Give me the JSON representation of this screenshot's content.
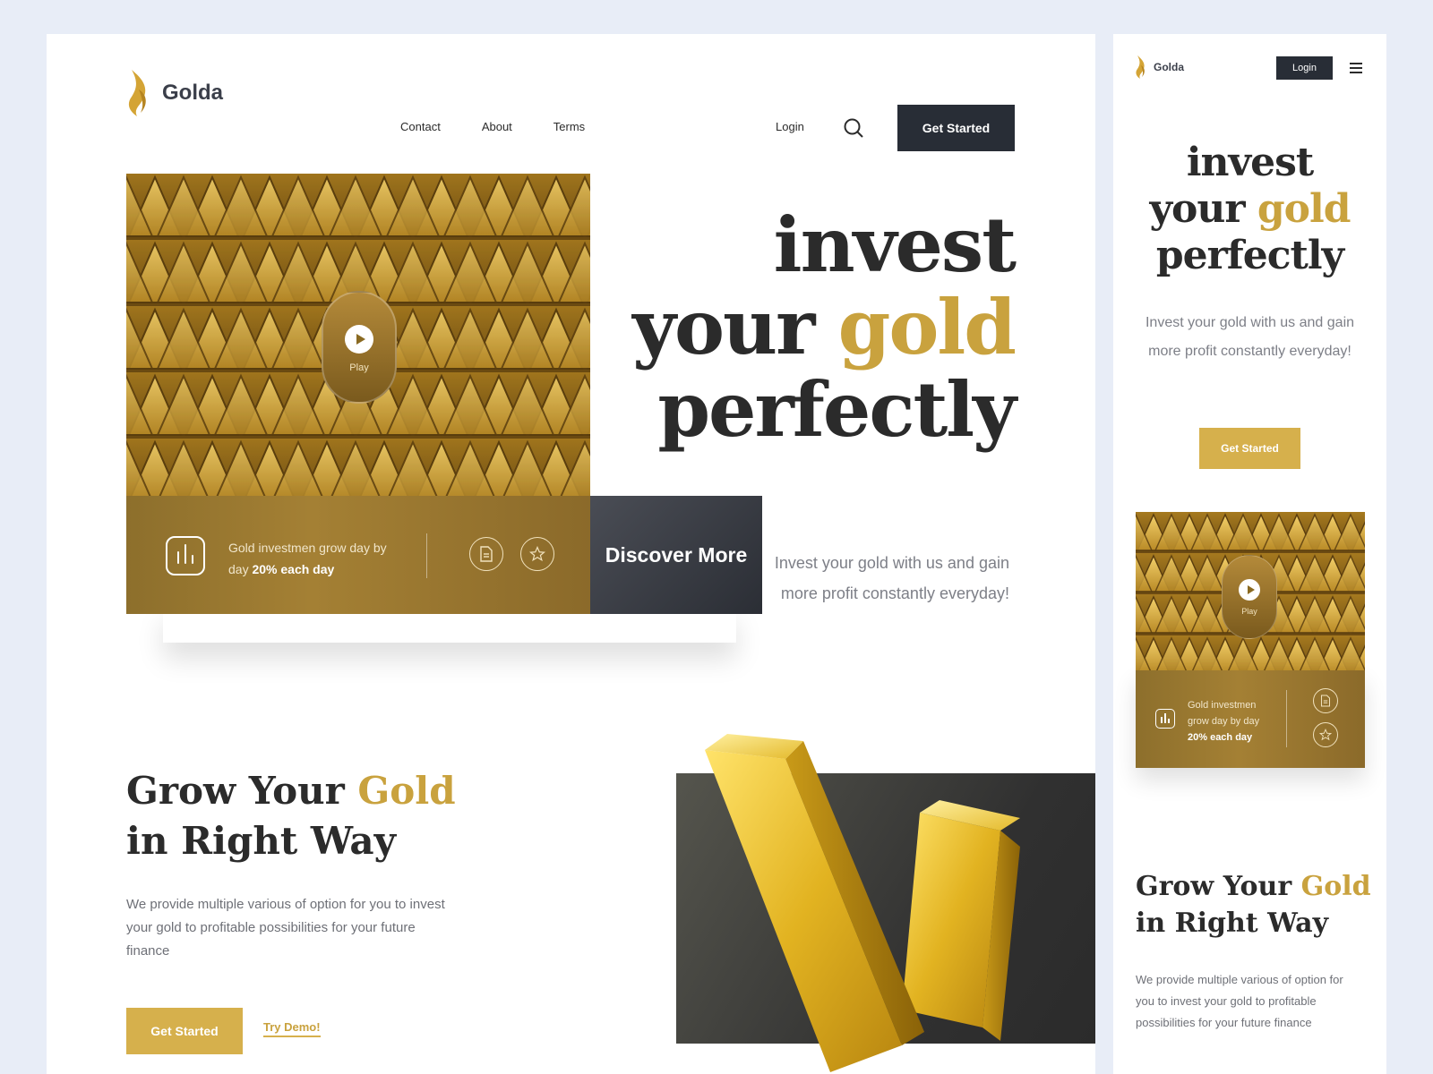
{
  "brand": {
    "name": "Golda",
    "color_gold": "#c9a23e",
    "color_dark": "#282d36"
  },
  "nav": {
    "items": [
      "Contact",
      "About",
      "Terms"
    ],
    "login_label": "Login",
    "cta_label": "Get Started",
    "search_icon": "search-icon"
  },
  "hero": {
    "headline_line1": "invest",
    "headline_line2_a": "your",
    "headline_gold": "gold",
    "headline_line3": "perfectly",
    "subtitle": "Invest your gold with us and gain more profit constantly everyday!",
    "play_label": "Play",
    "stat_text": "Gold investmen grow day by day",
    "stat_bold": "20% each day",
    "discover_label": "Discover More",
    "icons": [
      "bar-chart-icon",
      "document-icon",
      "star-icon"
    ]
  },
  "grow": {
    "title_a": "Grow Your",
    "title_gold": "Gold",
    "title_b": "in Right Way",
    "description": "We provide multiple various of option for you to invest your gold to profitable possibilities for your future finance",
    "cta_label": "Get Started",
    "demo_label": "Try Demo!"
  },
  "mobile": {
    "brand": "Golda",
    "login_label": "Login",
    "menu_icon": "hamburger-menu-icon",
    "headline_line1": "invest",
    "headline_line2_a": "your",
    "headline_gold": "gold",
    "headline_line3": "perfectly",
    "subtitle": "Invest your gold with us and gain more profit constantly everyday!",
    "cta_label": "Get Started",
    "play_label": "Play",
    "stat_text": "Gold investmen grow day by day",
    "stat_bold": "20% each day",
    "grow_title_a": "Grow Your",
    "grow_title_gold": "Gold",
    "grow_title_b": "in Right Way",
    "grow_description": "We provide multiple various of option for you to invest your gold to profitable possibilities for your future finance"
  }
}
